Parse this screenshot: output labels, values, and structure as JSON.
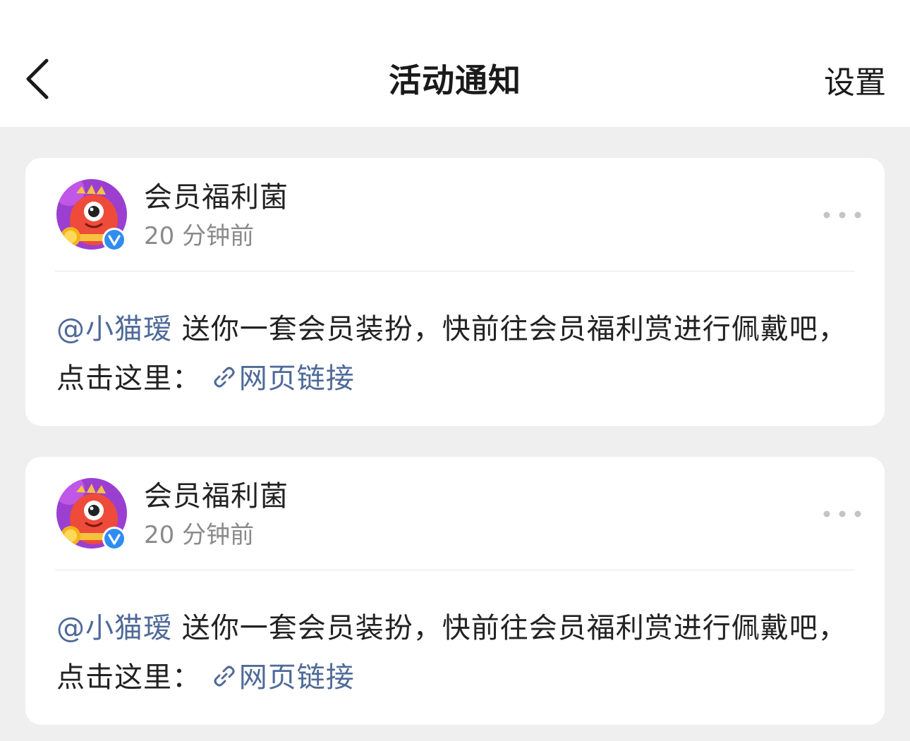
{
  "header": {
    "back_icon": "chevron-left-icon",
    "title": "活动通知",
    "settings_label": "设置"
  },
  "colors": {
    "page_background": "#efefef",
    "card_background": "#ffffff",
    "link_color": "#4f6a98",
    "secondary_text": "#8a8a8a",
    "verified_badge": "#2f8df2"
  },
  "notifications": [
    {
      "author": "会员福利菌",
      "time": "20 分钟前",
      "avatar_icon": "red-mascot-avatar-icon",
      "verified_icon": "verified-badge-icon",
      "more_icon": "more-dots-icon",
      "mention": "@小猫瑷",
      "message": " 送你一套会员装扮，快前往会员福利赏进行佩戴吧，点击这里： ",
      "link_icon": "link-icon",
      "link_text": "网页链接"
    },
    {
      "author": "会员福利菌",
      "time": "20 分钟前",
      "avatar_icon": "red-mascot-avatar-icon",
      "verified_icon": "verified-badge-icon",
      "more_icon": "more-dots-icon",
      "mention": "@小猫瑷",
      "message": " 送你一套会员装扮，快前往会员福利赏进行佩戴吧，点击这里： ",
      "link_icon": "link-icon",
      "link_text": "网页链接"
    }
  ]
}
